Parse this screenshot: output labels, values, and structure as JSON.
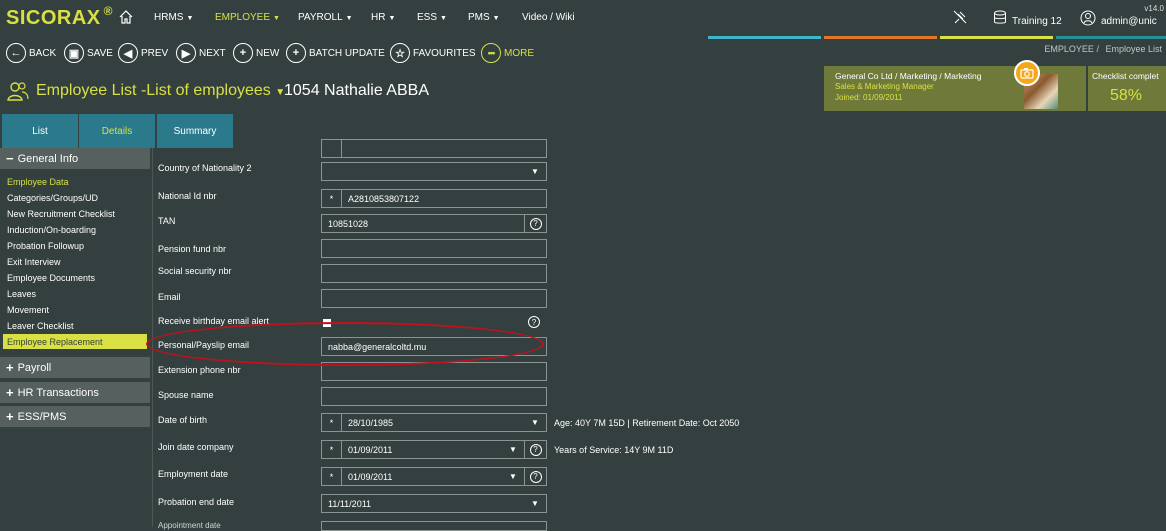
{
  "app": {
    "logo": "SICORAX",
    "logo_reg": "®",
    "version": "v14.0",
    "menu": [
      {
        "label": "HRMS",
        "active": false
      },
      {
        "label": "EMPLOYEE",
        "active": true
      },
      {
        "label": "PAYROLL",
        "active": false
      },
      {
        "label": "HR",
        "active": false
      },
      {
        "label": "ESS",
        "active": false
      },
      {
        "label": "PMS",
        "active": false
      },
      {
        "label": "Video / Wiki",
        "active": false
      }
    ],
    "database": "Training 12",
    "user": "admin@unic"
  },
  "toolbar": {
    "back": "BACK",
    "save": "SAVE",
    "prev": "PREV",
    "next": "NEXT",
    "new": "NEW",
    "batch_update": "BATCH UPDATE",
    "favourites": "FAVOURITES",
    "more": "MORE"
  },
  "breadcrumb": {
    "root": "EMPLOYEE /",
    "current": "Employee List"
  },
  "page": {
    "title": "Employee List -List of employees",
    "employee": "1054 Nathalie ABBA"
  },
  "employee_card": {
    "company": "General Co Ltd / Marketing / Marketing",
    "position": "Sales & Marketing Manager",
    "joined": "Joined: 01/09/2011"
  },
  "checklist": {
    "label": "Checklist complet",
    "percent": "58%"
  },
  "tabs": [
    "List",
    "Details",
    "Summary"
  ],
  "sidebar": {
    "general_info": "General Info",
    "items": [
      "Employee Data",
      "Categories/Groups/UD",
      "New Recruitment Checklist",
      "Induction/On-boarding",
      "Probation Followup",
      "Exit Interview",
      "Employee Documents",
      "Leaves",
      "Movement",
      "Leaver Checklist",
      "Employee Replacement"
    ],
    "payroll": "Payroll",
    "hr_transactions": "HR Transactions",
    "ess_pms": "ESS/PMS"
  },
  "form": {
    "country_nationality_2": {
      "label": "Country of Nationality 2",
      "value": ""
    },
    "national_id": {
      "label": "National Id nbr",
      "value": "A2810853807122"
    },
    "tan": {
      "label": "TAN",
      "value": "10851028"
    },
    "pension_fund": {
      "label": "Pension fund nbr",
      "value": ""
    },
    "social_security": {
      "label": "Social security nbr",
      "value": ""
    },
    "email": {
      "label": "Email",
      "value": ""
    },
    "birthday_alert": {
      "label": "Receive birthday email alert"
    },
    "payslip_email": {
      "label": "Personal/Payslip email",
      "value": "nabba@generalcoltd.mu"
    },
    "extension_phone": {
      "label": "Extension phone nbr",
      "value": ""
    },
    "spouse_name": {
      "label": "Spouse name",
      "value": ""
    },
    "date_of_birth": {
      "label": "Date of birth",
      "value": "28/10/1985",
      "info": "Age: 40Y 7M 15D | Retirement Date: Oct 2050"
    },
    "join_date_company": {
      "label": "Join date company",
      "value": "01/09/2011",
      "info": "Years of Service: 14Y 9M 11D"
    },
    "employment_date": {
      "label": "Employment date",
      "value": "01/09/2011"
    },
    "probation_end_date": {
      "label": "Probation end date",
      "value": "11/11/2011"
    },
    "appointment_date": {
      "label": "Appointment date"
    }
  },
  "colors": {
    "background": "#34403f",
    "accent": "#d8e042",
    "card": "#6f7a3a",
    "tab_active": "#2a7a8c",
    "annotation": "#c0121d"
  }
}
